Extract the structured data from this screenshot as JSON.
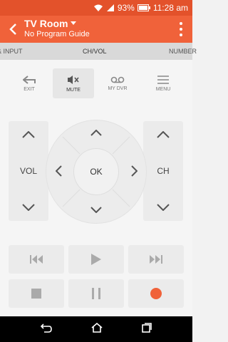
{
  "status_bar": {
    "battery_pct": "93%",
    "time": "11:28 am",
    "signal_label": "4G"
  },
  "app_bar": {
    "title": "TV Room",
    "subtitle": "No Program Guide"
  },
  "tabs": [
    {
      "label": "& INPUT"
    },
    {
      "label": "CH/VOL"
    },
    {
      "label": "NUMBER"
    }
  ],
  "top_buttons": [
    {
      "label": "EXIT",
      "icon": "exit-icon"
    },
    {
      "label": "MUTE",
      "icon": "mute-icon"
    },
    {
      "label": "MY DVR",
      "icon": "dvr-icon"
    },
    {
      "label": "MENU",
      "icon": "menu-icon"
    }
  ],
  "rockers": {
    "vol_label": "VOL",
    "ch_label": "CH"
  },
  "dpad": {
    "ok_label": "OK"
  },
  "media": [
    {
      "icon": "skip-back-icon"
    },
    {
      "icon": "play-icon"
    },
    {
      "icon": "skip-forward-icon"
    },
    {
      "icon": "stop-icon"
    },
    {
      "icon": "pause-icon"
    },
    {
      "icon": "record-icon"
    }
  ],
  "colors": {
    "accent": "#f0623a",
    "status_bar": "#e3522b",
    "record": "#f0623a"
  }
}
